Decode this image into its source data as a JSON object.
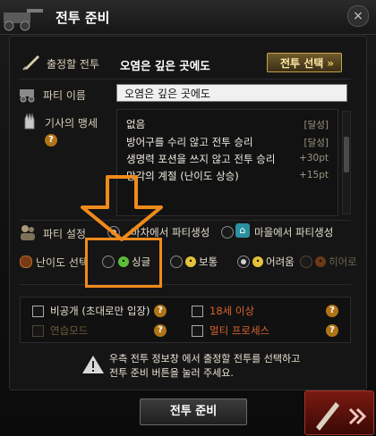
{
  "window": {
    "title": "전투 준비",
    "close_label": "×"
  },
  "destination": {
    "label": "출정할 전투",
    "value": "오염은 깊은 곳에도",
    "select_button": "전투 선택",
    "select_arrow": "»"
  },
  "party_name": {
    "label": "파티 이름",
    "value": "오염은 깊은 곳에도"
  },
  "oath": {
    "label": "기사의 맹세",
    "help": "?",
    "items": [
      {
        "name": "없음",
        "value": "[달성]"
      },
      {
        "name": "방어구를 수리 않고 전투 승리",
        "value": "[달성]"
      },
      {
        "name": "생명력 포션을 쓰지 않고 전투 승리",
        "value": "+30pt"
      },
      {
        "name": "망각의 계절 (난이도 상승)",
        "value": "+15pt"
      }
    ]
  },
  "party_setting": {
    "label": "파티 설정",
    "options": [
      {
        "label": "마차에서 파티생성",
        "selected": true
      },
      {
        "label": "마을에서 파티생성",
        "selected": false
      }
    ]
  },
  "difficulty": {
    "label": "난이도 선택",
    "options": [
      {
        "label": "싱글",
        "selected": false,
        "face_color": "#5bbd3a",
        "dim": false
      },
      {
        "label": "보통",
        "selected": false,
        "face_color": "#e3c13a",
        "dim": false
      },
      {
        "label": "어려움",
        "selected": true,
        "face_color": "#e3c13a",
        "dim": false
      },
      {
        "label": "히어로",
        "selected": false,
        "face_color": "#6a3a18",
        "dim": true
      }
    ]
  },
  "options": {
    "private": "비공개 (초대로만 입장)",
    "age18": "18세 이상",
    "practice": "연습모드",
    "multi": "멀티 프로세스",
    "help": "?"
  },
  "notice": {
    "line1": "우측 전투 정보창 에서 출정할 전투를 선택하고",
    "line2": "전투 준비 버튼을 눌러 주세요."
  },
  "ready_button": "전투 준비",
  "colors": {
    "accent_gold": "#c9a24a",
    "highlight_orange": "#f08a1c",
    "help_orange": "#b07417",
    "red_text": "#d8622c"
  }
}
